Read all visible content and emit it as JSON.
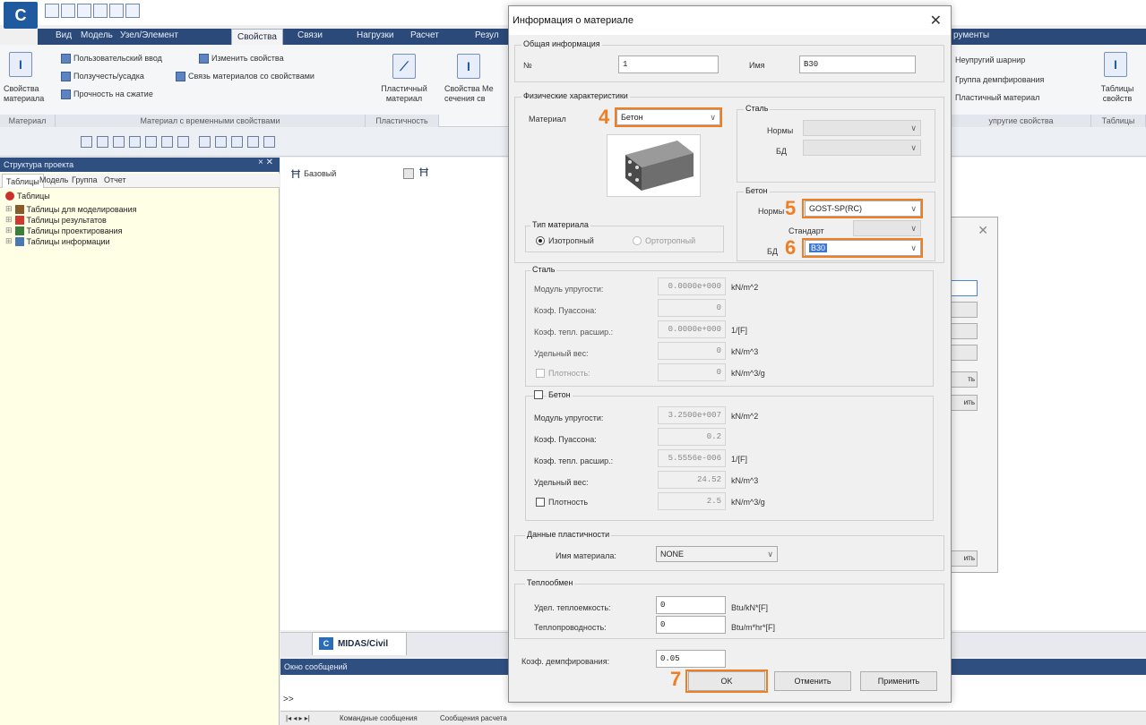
{
  "app": {
    "logo": "C",
    "ribbon_tabs": [
      "Вид",
      "Модель",
      "Узел/Элемент",
      "Свойства",
      "Связи",
      "Нагрузки",
      "Расчет",
      "Резул",
      "рументы"
    ],
    "active_tab": "Свойства",
    "ribbon": {
      "material_btn": "Свойства\nматериала",
      "user_input": "Пользовательский ввод",
      "change_props": "Изменить свойства",
      "creep": "Ползучесть/усадка",
      "link_material": "Связь материалов со свойствами",
      "comp_strength": "Прочность на сжатие",
      "plastic_material": "Пластичный\nматериал",
      "section_props": "Свойства Ме\nсечения св",
      "inelastic_hinge": "Неупругий шарнир",
      "damping_group": "Группа демпфирования",
      "plastic_material_menu": "Пластичный материал",
      "props_tables": "Таблицы\nсвойств",
      "group_material": "Материал",
      "group_time_dependent": "Материал с временными свойствами",
      "group_plasticity": "Пластичность",
      "group_inelastic": "упругие свойства",
      "group_tables": "Таблицы"
    }
  },
  "tree": {
    "header": "Структура проекта",
    "tabs": [
      "Таблицы",
      "Модель",
      "Группа",
      "Отчет"
    ],
    "root": "Таблицы",
    "items": [
      "Таблицы для моделирования",
      "Таблицы результатов",
      "Таблицы проектирования",
      "Таблицы информации"
    ]
  },
  "canvas": {
    "view_label": "Базовый"
  },
  "bottom": {
    "midas_tab": "MIDAS/Civil",
    "messages_header": "Окно сообщений",
    "prompt": ">>",
    "msg_tabs": [
      "Командные сообщения",
      "Сообщения расчета"
    ]
  },
  "back_dialog": {
    "buttons": [
      "ть",
      "ить",
      "ить"
    ]
  },
  "dialog": {
    "title": "Информация о материале",
    "general": {
      "label": "Общая информация",
      "num_label": "№",
      "num_value": "1",
      "name_label": "Имя",
      "name_value": "B30"
    },
    "physical": {
      "label": "Физические характеристики",
      "material_label": "Материал",
      "material_value": "Бетон",
      "steel_group_label": "Сталь",
      "steel_norms_label": "Нормы",
      "steel_db_label": "БД",
      "concrete_group_label": "Бетон",
      "concrete_norms_label": "Нормы",
      "concrete_norms_value": "GOST-SP(RC)",
      "standard_label": "Стандарт",
      "concrete_db_label": "БД",
      "concrete_db_value": "B30",
      "material_type_label": "Тип материала",
      "isotropic": "Изотропный",
      "orthotropic": "Ортотропный"
    },
    "steel": {
      "label": "Сталь",
      "elastic_label": "Модуль упругости:",
      "elastic_value": "0.0000e+000",
      "elastic_unit": "kN/m^2",
      "poisson_label": "Коэф. Пуассона:",
      "poisson_value": "0",
      "thermal_label": "Коэф. тепл. расшир.:",
      "thermal_value": "0.0000e+000",
      "thermal_unit": "1/[F]",
      "weight_label": "Удельный вес:",
      "weight_value": "0",
      "weight_unit": "kN/m^3",
      "density_label": "Плотность:",
      "density_value": "0",
      "density_unit": "kN/m^3/g"
    },
    "concrete": {
      "label": "Бетон",
      "elastic_label": "Модуль упругости:",
      "elastic_value": "3.2500e+007",
      "elastic_unit": "kN/m^2",
      "poisson_label": "Коэф. Пуассона:",
      "poisson_value": "0.2",
      "thermal_label": "Коэф. тепл. расшир.:",
      "thermal_value": "5.5556e-006",
      "thermal_unit": "1/[F]",
      "weight_label": "Удельный вес:",
      "weight_value": "24.52",
      "weight_unit": "kN/m^3",
      "density_label": "Плотность",
      "density_value": "2.5",
      "density_unit": "kN/m^3/g"
    },
    "plasticity": {
      "label": "Данные пластичности",
      "material_name_label": "Имя материала:",
      "material_name_value": "NONE"
    },
    "heat": {
      "label": "Теплообмен",
      "capacity_label": "Удел. теплоемкость:",
      "capacity_value": "0",
      "capacity_unit": "Btu/kN*[F]",
      "conductivity_label": "Теплопроводность:",
      "conductivity_value": "0",
      "conductivity_unit": "Btu/m*hr*[F]"
    },
    "damping_label": "Коэф. демпфирования:",
    "damping_value": "0.05",
    "buttons": {
      "ok": "OK",
      "cancel": "Отменить",
      "apply": "Применить"
    },
    "steps": [
      "4",
      "5",
      "6",
      "7"
    ],
    "highlight_color": "#ef7d22"
  }
}
